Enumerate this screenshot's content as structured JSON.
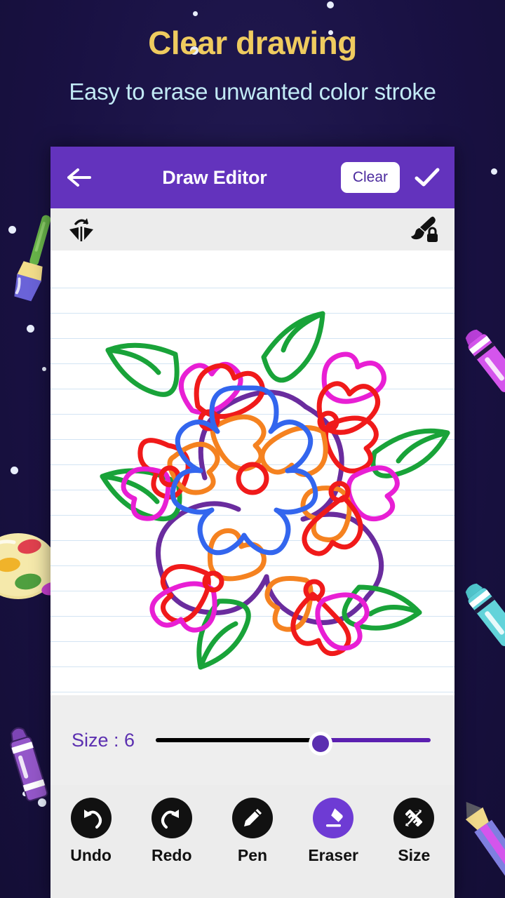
{
  "promo": {
    "headline": "Clear drawing",
    "subheadline": "Easy to erase unwanted color stroke",
    "headline_color": "#efcb5f",
    "subheadline_color": "#c2eaf5",
    "background_color": "#1a1247"
  },
  "appbar": {
    "title": "Draw Editor",
    "back_icon": "arrow-left-icon",
    "clear_label": "Clear",
    "confirm_icon": "check-icon",
    "background_color": "#6333bd"
  },
  "toolstrip": {
    "left_icon": "flip-horizontal-icon",
    "right_icon": "brush-lock-icon",
    "background_color": "#ececec"
  },
  "size_panel": {
    "label": "Size : 6",
    "value": 6,
    "min": 1,
    "max": 10,
    "percent": 60,
    "track_filled_color": "#000000",
    "track_remaining_color": "#5b1fb0",
    "thumb_color": "#5b2fb0"
  },
  "tools": [
    {
      "label": "Undo",
      "icon": "undo-icon",
      "active": false
    },
    {
      "label": "Redo",
      "icon": "redo-icon",
      "active": false
    },
    {
      "label": "Pen",
      "icon": "pencil-icon",
      "active": false
    },
    {
      "label": "Eraser",
      "icon": "eraser-icon",
      "active": true
    },
    {
      "label": "Size",
      "icon": "ruler-icon",
      "active": false
    }
  ],
  "canvas": {
    "paper": "lined-paper",
    "line_color": "#d3e4f3",
    "drawing": "floral-mandala",
    "stroke_colors": {
      "stem": "#6a2c9e",
      "center_flower": "#3366ee",
      "center_dot": "#f01a1a",
      "petal_red": "#f01a1a",
      "petal_magenta": "#e81fd4",
      "petal_orange": "#f58220",
      "leaf_green": "#19a339"
    }
  },
  "decorations": [
    {
      "name": "paintbrush",
      "position": "left-upper"
    },
    {
      "name": "palette",
      "position": "left-lower"
    },
    {
      "name": "crayon-purple",
      "position": "left-bottom"
    },
    {
      "name": "marker-magenta",
      "position": "right-upper"
    },
    {
      "name": "marker-cyan",
      "position": "right-lower"
    },
    {
      "name": "pencil-magenta",
      "position": "right-bottom"
    }
  ]
}
